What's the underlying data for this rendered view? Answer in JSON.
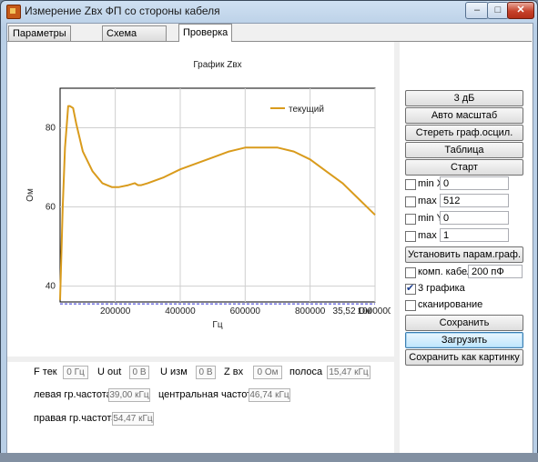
{
  "window": {
    "title": "Измерение Zвх ФП со стороны кабеля"
  },
  "tabs": [
    {
      "label": "Параметры проверки"
    },
    {
      "label": "Схема соединения"
    },
    {
      "label": "Проверка"
    }
  ],
  "buttons": {
    "b3db": "3 дБ",
    "auto_scale": "Авто масштаб",
    "erase": "Стереть граф.осцил.",
    "table": "Таблица",
    "start": "Старт",
    "set_params": "Установить парам.граф.",
    "save": "Сохранить",
    "load": "Загрузить",
    "save_image": "Сохранить как картинку"
  },
  "limits": {
    "min_x": {
      "label": "min X",
      "value": "0",
      "checked": false
    },
    "max_x": {
      "label": "max X",
      "value": "512",
      "checked": false
    },
    "min_y": {
      "label": "min Y",
      "value": "0",
      "checked": false
    },
    "max_y": {
      "label": "max Y",
      "value": "1",
      "checked": false
    }
  },
  "options": {
    "cable": {
      "label": "комп. кабеля",
      "value": "200  пФ",
      "checked": false
    },
    "three_graphs": {
      "label": "3 графика",
      "checked": true
    },
    "scanning": {
      "label": "сканирование",
      "checked": false
    }
  },
  "readouts": {
    "f_label": "F тек",
    "f_value": "0  Гц",
    "uout_label": "U out",
    "uout_value": "0  В",
    "uizm_label": "U изм",
    "uizm_value": "0  В",
    "zvx_label": "Z вх",
    "zvx_value": "0  Ом",
    "band_label": "полоса",
    "band_value": "15,47 кГц",
    "left_label": "левая гр.частота",
    "left_value": "39,00 кГц",
    "center_label": "центральная частота",
    "center_value": "46,74 кГц",
    "right_label": "правая гр.частота",
    "right_value": "54,47 кГц"
  },
  "chart_data": {
    "type": "line",
    "title": "График Zвх",
    "xlabel": "Гц",
    "ylabel": "Ом",
    "xlim": [
      30000,
      1000000
    ],
    "ylim": [
      36,
      90
    ],
    "x_ticks": [
      200000,
      400000,
      600000,
      800000,
      1000000
    ],
    "y_ticks": [
      40,
      60,
      80
    ],
    "grid": true,
    "legend": "top-right",
    "series": [
      {
        "name": "текущий",
        "color": "#d99b1c",
        "x": [
          30000,
          38000,
          45000,
          50000,
          55000,
          60000,
          70000,
          80000,
          100000,
          130000,
          160000,
          190000,
          210000,
          240000,
          260000,
          270000,
          280000,
          300000,
          350000,
          400000,
          450000,
          500000,
          550000,
          600000,
          650000,
          700000,
          750000,
          800000,
          850000,
          900000,
          950000,
          1000000
        ],
        "y": [
          36.5,
          60,
          75,
          80,
          85.5,
          85.5,
          85,
          81,
          74,
          69,
          66,
          65,
          65,
          65.5,
          66,
          65.5,
          65.5,
          66,
          67.5,
          69.5,
          71,
          72.5,
          74,
          75,
          75,
          75,
          74,
          72,
          69,
          66,
          62,
          58
        ]
      },
      {
        "name": "",
        "color": "#2a2ad0",
        "dashed": true,
        "x": [
          30000,
          1000000
        ],
        "y": [
          35.52,
          35.52
        ]
      }
    ],
    "annotations": [
      {
        "text": "35,52 Ом"
      }
    ]
  }
}
